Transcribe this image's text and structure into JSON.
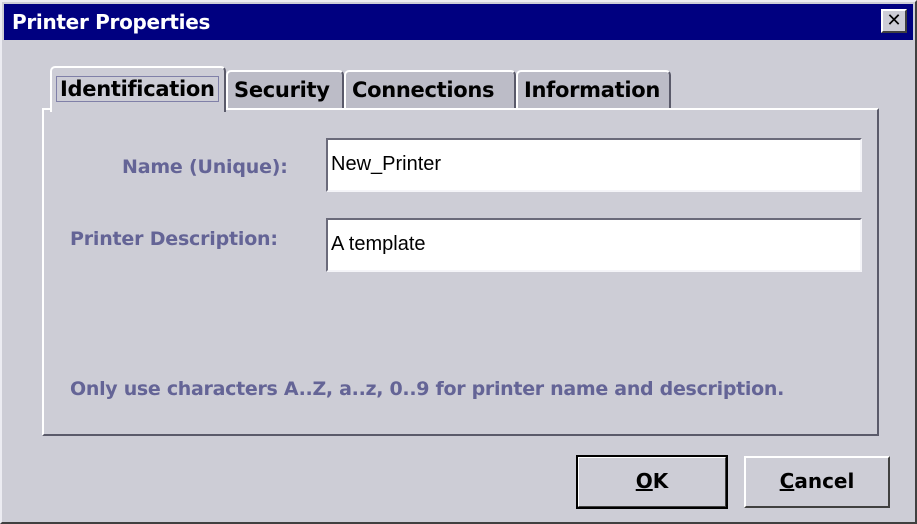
{
  "window": {
    "title": "Printer Properties",
    "close_glyph": "✕",
    "close_icon": "close-icon"
  },
  "tabs": [
    {
      "label": "Identification",
      "selected": true
    },
    {
      "label": "Security",
      "selected": false
    },
    {
      "label": "Connections",
      "selected": false
    },
    {
      "label": "Information",
      "selected": false
    }
  ],
  "form": {
    "name_label": "Name (Unique):",
    "name_value": "New_Printer",
    "description_label": "Printer Description:",
    "description_value": "A template",
    "hint": "Only use characters A..Z, a..z, 0..9 for printer name and description."
  },
  "buttons": {
    "ok": {
      "mnemonic": "O",
      "rest": "K"
    },
    "cancel": {
      "mnemonic": "C",
      "rest": "ancel"
    }
  },
  "colors": {
    "titlebar": "#000080",
    "label_text": "#646496",
    "face": "#cdcdd6"
  }
}
